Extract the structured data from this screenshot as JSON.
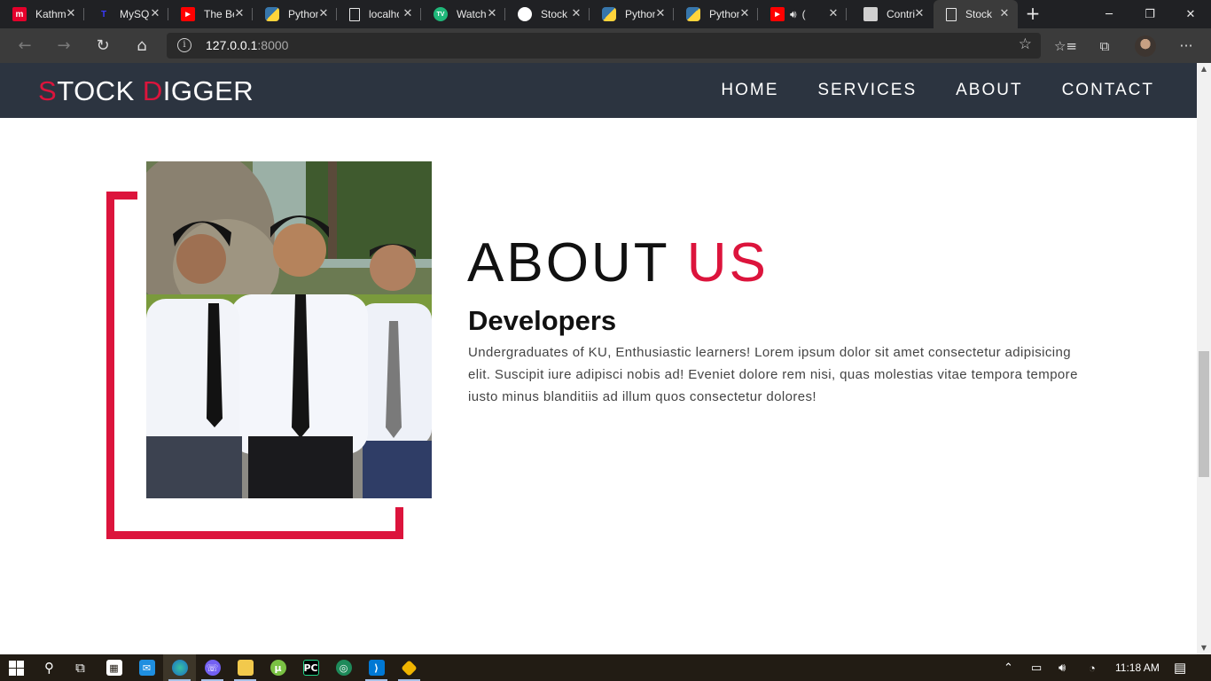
{
  "browser": {
    "tabs": [
      {
        "title": "Kathmandu",
        "icon": "mero-icon",
        "color": "#e4002b",
        "glyph": "m"
      },
      {
        "title": "MySQL",
        "icon": "mysql-icon",
        "color": "#1b1bbf",
        "glyph": "T"
      },
      {
        "title": "The Best",
        "icon": "youtube-icon",
        "color": "#ff0000",
        "glyph": "▶"
      },
      {
        "title": "Python",
        "icon": "python-icon",
        "color": "#3776ab",
        "glyph": "⌘"
      },
      {
        "title": "localhost",
        "icon": "page-icon",
        "color": "#3b3b3b",
        "glyph": "▯"
      },
      {
        "title": "Watch",
        "icon": "tradingview-icon",
        "color": "#1fb87a",
        "glyph": "TV"
      },
      {
        "title": "Stock",
        "icon": "github-icon",
        "color": "#ffffff",
        "glyph": "●"
      },
      {
        "title": "Python",
        "icon": "python-icon",
        "color": "#3776ab",
        "glyph": "⌘"
      },
      {
        "title": "Python",
        "icon": "python-icon",
        "color": "#3776ab",
        "glyph": "⌘"
      },
      {
        "title": "(",
        "icon": "youtube-audio-icon",
        "color": "#ff0000",
        "glyph": "▶"
      },
      {
        "title": "Contri",
        "icon": "contributor-icon",
        "color": "#d0d0d0",
        "glyph": "▣"
      },
      {
        "title": "Stock",
        "icon": "page-icon",
        "color": "#3b3b3b",
        "glyph": "▯"
      }
    ],
    "url_host": "127.0.0.1",
    "url_port": ":8000"
  },
  "site": {
    "logo_first_letter": "S",
    "logo_first_rest": "TOCK ",
    "logo_second_letter": "D",
    "logo_second_rest": "IGGER",
    "nav": {
      "home": "HOME",
      "services": "SERVICES",
      "about": "ABOUT",
      "contact": "CONTACT"
    },
    "about": {
      "title_part1": "ABOUT ",
      "title_part2": "US",
      "subheading": "Developers",
      "body": "Undergraduates of KU, Enthusiastic learners! Lorem ipsum dolor sit amet consectetur adipisicing elit. Suscipit iure adipisci nobis ad! Eveniet dolore rem nisi, quas molestias vitae tempora tempore iusto minus blanditiis ad illum quos consectetur dolores!"
    },
    "accent_color": "#dc143c",
    "navbar_color": "#2c3440"
  },
  "taskbar": {
    "clock": "11:18 AM",
    "apps": [
      "start-icon",
      "search-icon",
      "task-view-icon",
      "store-icon",
      "mail-icon",
      "edge-icon",
      "viber-icon",
      "file-explorer-icon",
      "utorrent-icon",
      "pycharm-icon",
      "git-kraken-icon",
      "vscode-icon",
      "git-icon"
    ]
  }
}
